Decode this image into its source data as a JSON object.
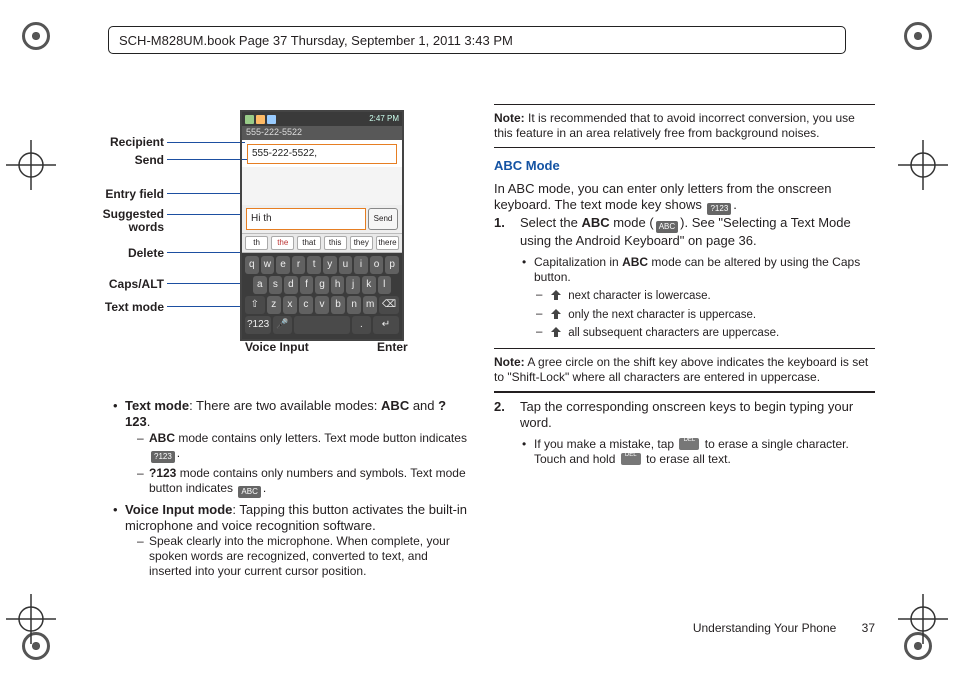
{
  "frame_header": "SCH-M828UM.book  Page 37  Thursday, September 1, 2011  3:43 PM",
  "phone": {
    "time": "2:47 PM",
    "recipient_bar": "555-222-5522",
    "recipient_input": "555-222-5522,",
    "entry_text": "Hi th",
    "send_btn": "Send",
    "suggestions": [
      "th",
      "the",
      "that",
      "this",
      "they",
      "there"
    ],
    "rows": [
      [
        "q",
        "w",
        "e",
        "r",
        "t",
        "y",
        "u",
        "i",
        "o",
        "p"
      ],
      [
        "a",
        "s",
        "d",
        "f",
        "g",
        "h",
        "j",
        "k",
        "l"
      ]
    ],
    "row3": {
      "shift": "⇧",
      "keys": [
        "z",
        "x",
        "c",
        "v",
        "b",
        "n",
        "m"
      ],
      "del": "⌫"
    },
    "row4": {
      "mode": "?123",
      "mic": "🎤",
      "space": "",
      "dot": ".",
      "enter": "↵"
    }
  },
  "callouts": {
    "recipient": "Recipient",
    "send": "Send",
    "entry": "Entry field",
    "suggested_l1": "Suggested",
    "suggested_l2": "words",
    "delete": "Delete",
    "caps": "Caps/ALT",
    "textmode": "Text mode",
    "voice": "Voice Input",
    "enter": "Enter"
  },
  "left_body": {
    "tm_lead_a": "Text mode",
    "tm_lead_b": ": There are two available modes: ",
    "tm_lead_c": "ABC",
    "tm_lead_d": " and ",
    "tm_lead_e": "?123",
    "tm_lead_f": ".",
    "tm_sub1_a": "ABC",
    "tm_sub1_b": " mode contains only letters. Text mode button indicates ",
    "tm_sub1_icon": "?123",
    "tm_sub1_c": ".",
    "tm_sub2_a": "?123",
    "tm_sub2_b": " mode contains only numbers and symbols. Text mode button indicates ",
    "tm_sub2_icon": "ABC",
    "tm_sub2_c": ".",
    "vi_a": "Voice Input mode",
    "vi_b": ": Tapping this button activates the built-in microphone and voice recognition software.",
    "vi_sub": "Speak clearly into the microphone. When complete, your spoken words are recognized, converted to text, and inserted into your current cursor position."
  },
  "right_body": {
    "note1_label": "Note:",
    "note1": " It is recommended that to avoid incorrect conversion, you use this feature in an area relatively free from background noises.",
    "hdr": "ABC Mode",
    "intro_a": "In ABC mode, you can enter only letters from the onscreen keyboard. The text mode key shows ",
    "intro_icon": "?123",
    "intro_b": ".",
    "step1_a": "Select the ",
    "step1_b": "ABC",
    "step1_c": " mode (",
    "step1_icon": "ABC",
    "step1_d": "). See \"Selecting a Text Mode using the Android Keyboard\" on page 36.",
    "cap_a": "Capitalization in ",
    "cap_b": "ABC",
    "cap_c": " mode can be altered by using the Caps button.",
    "cap_s1": " next character is lowercase.",
    "cap_s2": " only the next character is uppercase.",
    "cap_s3": " all subsequent characters are uppercase.",
    "note2_label": "Note:",
    "note2": " A gree circle on the shift key above indicates the keyboard is set to \"Shift-Lock\" where all characters are entered in uppercase.",
    "step2": "Tap the corresponding onscreen keys to begin typing your word.",
    "mistake_a": "If you make a mistake, tap ",
    "mistake_b": " to erase a single character. Touch and hold ",
    "mistake_c": " to erase all text."
  },
  "footer": {
    "section": "Understanding Your Phone",
    "page": "37"
  }
}
